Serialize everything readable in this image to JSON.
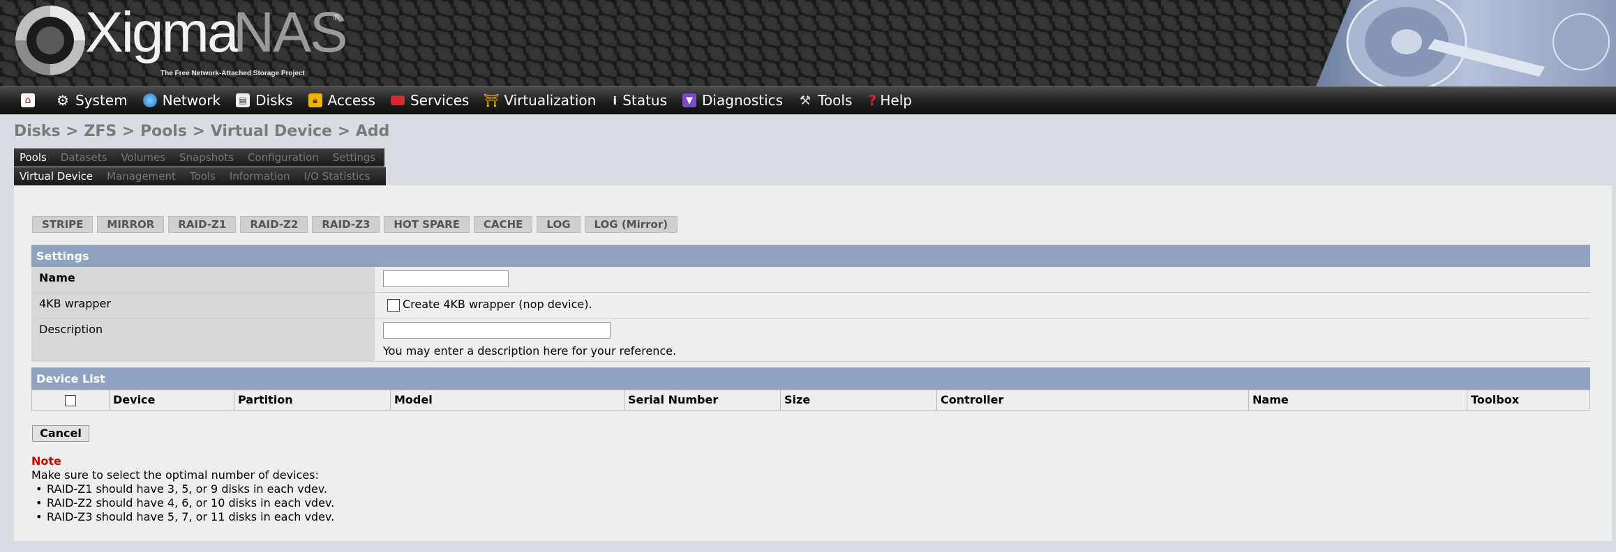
{
  "header": {
    "logo_primary": "Xigma",
    "logo_secondary": "NAS",
    "logo_reg": "®",
    "tagline": "The Free Network-Attached Storage Project"
  },
  "nav": {
    "items": [
      {
        "label": "",
        "icon": "home-icon"
      },
      {
        "label": "System",
        "icon": "gear-icon"
      },
      {
        "label": "Network",
        "icon": "globe-icon"
      },
      {
        "label": "Disks",
        "icon": "disk-icon"
      },
      {
        "label": "Access",
        "icon": "lock-icon"
      },
      {
        "label": "Services",
        "icon": "toolbox-icon"
      },
      {
        "label": "Virtualization",
        "icon": "crane-icon"
      },
      {
        "label": "Status",
        "icon": "info-icon"
      },
      {
        "label": "Diagnostics",
        "icon": "funnel-icon"
      },
      {
        "label": "Tools",
        "icon": "wrench-icon"
      },
      {
        "label": "Help",
        "icon": "question-icon"
      }
    ]
  },
  "breadcrumb": "Disks > ZFS > Pools > Virtual Device > Add",
  "tabs_primary": [
    "Pools",
    "Datasets",
    "Volumes",
    "Snapshots",
    "Configuration",
    "Settings"
  ],
  "tabs_secondary": [
    "Virtual Device",
    "Management",
    "Tools",
    "Information",
    "I/O Statistics"
  ],
  "vdev_types": [
    "STRIPE",
    "MIRROR",
    "RAID-Z1",
    "RAID-Z2",
    "RAID-Z3",
    "HOT SPARE",
    "CACHE",
    "LOG",
    "LOG (Mirror)"
  ],
  "settings": {
    "title": "Settings",
    "name_label": "Name",
    "name_value": "",
    "wrapper_label": "4KB wrapper",
    "wrapper_text": "Create 4KB wrapper (nop device).",
    "description_label": "Description",
    "description_value": "",
    "description_hint": "You may enter a description here for your reference."
  },
  "device_list": {
    "title": "Device List",
    "columns": [
      "Device",
      "Partition",
      "Model",
      "Serial Number",
      "Size",
      "Controller",
      "Name",
      "Toolbox"
    ]
  },
  "cancel_label": "Cancel",
  "note": {
    "title": "Note",
    "intro": "Make sure to select the optimal number of devices:",
    "items": [
      "RAID-Z1 should have 3, 5, or 9 disks in each vdev.",
      "RAID-Z2 should have 4, 6, or 10 disks in each vdev.",
      "RAID-Z3 should have 5, 7, or 11 disks in each vdev."
    ]
  },
  "colors": {
    "section_header": "#8fa2c2",
    "note_title": "#c80000",
    "panel_bg": "#eeeeee"
  }
}
